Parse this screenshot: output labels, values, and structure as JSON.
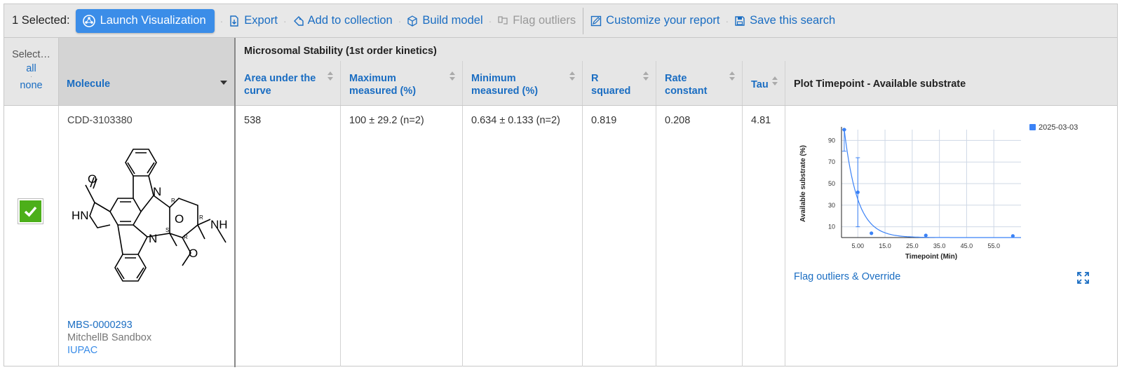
{
  "toolbar": {
    "selected_label": "1 Selected:",
    "launch_label": "Launch Visualization",
    "export_label": "Export",
    "add_collection_label": "Add to collection",
    "build_model_label": "Build model",
    "flag_outliers_label": "Flag outliers",
    "customize_label": "Customize your report",
    "save_search_label": "Save this search"
  },
  "header": {
    "select_label": "Select…",
    "select_all": "all",
    "select_none": "none",
    "molecule_col": "Molecule",
    "group_title": "Microsomal Stability (1st order kinetics)",
    "columns": {
      "auc": [
        "Area under the",
        "curve"
      ],
      "max": [
        "Maximum",
        "measured (%)"
      ],
      "min": [
        "Minimum",
        "measured (%)"
      ],
      "r2": [
        "R",
        "squared"
      ],
      "rate": [
        "Rate",
        "constant"
      ],
      "tau": "Tau",
      "plot": "Plot Timepoint - Available substrate"
    }
  },
  "row": {
    "checked": true,
    "molecule_id": "CDD-3103380",
    "batch_id": "MBS-0000293",
    "vault": "MitchellB Sandbox",
    "iupac_label": "IUPAC",
    "auc": "538",
    "max": "100 ± 29.2 (n=2)",
    "min": "0.634 ± 0.133 (n=2)",
    "r2": "0.819",
    "rate": "0.208",
    "tau": "4.81",
    "flag_link": "Flag outliers & Override",
    "structure_labels": {
      "o_carbonyl": "O",
      "hn": "HN",
      "n_top": "N",
      "n_bottom": "N",
      "o_ring": "O",
      "nh": "NH",
      "o_methoxy": "O",
      "r1": "R",
      "r2": "R",
      "r3": "R",
      "s1": "S"
    }
  },
  "colors": {
    "accent": "#1a6dc2",
    "button": "#3b8de8",
    "check": "#4caf1a",
    "series": "#3b82f6"
  },
  "chart_data": {
    "type": "scatter",
    "title": "",
    "xlabel": "Timepoint (Min)",
    "ylabel": "Available substrate (%)",
    "x_ticks": [
      "5.00",
      "15.0",
      "25.0",
      "35.0",
      "45.0",
      "55.0"
    ],
    "y_ticks": [
      "10",
      "30",
      "50",
      "70",
      "90"
    ],
    "xlim": [
      -1,
      65
    ],
    "ylim": [
      0,
      100
    ],
    "grid": true,
    "legend_position": "top-right",
    "series": [
      {
        "name": "2025-03-03",
        "points": [
          {
            "x": 0,
            "y": 100,
            "err_lo": 80,
            "err_hi": 100
          },
          {
            "x": 5,
            "y": 42,
            "err_lo": 10,
            "err_hi": 74
          },
          {
            "x": 10,
            "y": 4
          },
          {
            "x": 30,
            "y": 2
          },
          {
            "x": 62,
            "y": 1.5
          }
        ],
        "fit": {
          "model": "first_order_decay",
          "y0": 100,
          "k": 0.208
        }
      }
    ]
  }
}
